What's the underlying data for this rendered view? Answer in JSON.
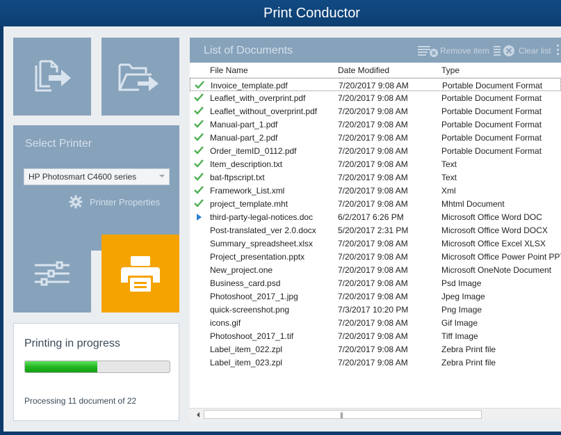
{
  "window": {
    "title": "Print Conductor"
  },
  "toolbar": {
    "add_files_icon": "add-files-icon",
    "add_folder_icon": "add-folder-icon",
    "settings_icon": "sliders-icon",
    "print_icon": "printer-icon"
  },
  "printer": {
    "section_label": "Select Printer",
    "selected": "HP Photosmart C4600 series",
    "properties_label": "Printer Properties"
  },
  "progress": {
    "title": "Printing in progress",
    "fraction": 0.5,
    "status_text": "Processing 11 document of 22"
  },
  "documents": {
    "title": "List of Documents",
    "remove_label": "Remove item",
    "clear_label": "Clear list",
    "columns": {
      "name": "File Name",
      "date": "Date Modified",
      "type": "Type"
    },
    "rows": [
      {
        "name": "Invoice_template.pdf",
        "date": "7/20/2017 9:08 AM",
        "type": "Portable Document Format",
        "status": "done"
      },
      {
        "name": "Leaflet_with_overprint.pdf",
        "date": "7/20/2017 9:08 AM",
        "type": "Portable Document Format",
        "status": "done"
      },
      {
        "name": "Leaflet_without_overprint.pdf",
        "date": "7/20/2017 9:08 AM",
        "type": "Portable Document Format",
        "status": "done"
      },
      {
        "name": "Manual-part_1.pdf",
        "date": "7/20/2017 9:08 AM",
        "type": "Portable Document Format",
        "status": "done"
      },
      {
        "name": "Manual-part_2.pdf",
        "date": "7/20/2017 9:08 AM",
        "type": "Portable Document Format",
        "status": "done"
      },
      {
        "name": "Order_itemID_0112.pdf",
        "date": "7/20/2017 9:08 AM",
        "type": "Portable Document Format",
        "status": "done"
      },
      {
        "name": "Item_description.txt",
        "date": "7/20/2017 9:08 AM",
        "type": "Text",
        "status": "done"
      },
      {
        "name": "bat-ftpscript.txt",
        "date": "7/20/2017 9:08 AM",
        "type": "Text",
        "status": "done"
      },
      {
        "name": "Framework_List.xml",
        "date": "7/20/2017 9:08 AM",
        "type": "Xml",
        "status": "done"
      },
      {
        "name": "project_template.mht",
        "date": "7/20/2017 9:08 AM",
        "type": "Mhtml Document",
        "status": "done"
      },
      {
        "name": "third-party-legal-notices.doc",
        "date": "6/2/2017 6:26 PM",
        "type": "Microsoft Office Word DOC",
        "status": "current"
      },
      {
        "name": "Post-translated_ver 2.0.docx",
        "date": "5/20/2017 2:31 PM",
        "type": "Microsoft Office Word DOCX",
        "status": ""
      },
      {
        "name": "Summary_spreadsheet.xlsx",
        "date": "7/20/2017 9:08 AM",
        "type": "Microsoft Office Excel XLSX",
        "status": ""
      },
      {
        "name": "Project_presentation.pptx",
        "date": "7/20/2017 9:08 AM",
        "type": "Microsoft Office Power Point PPT",
        "status": ""
      },
      {
        "name": "New_project.one",
        "date": "7/20/2017 9:08 AM",
        "type": "Microsoft OneNote Document",
        "status": ""
      },
      {
        "name": "Business_card.psd",
        "date": "7/20/2017 9:08 AM",
        "type": "Psd Image",
        "status": ""
      },
      {
        "name": "Photoshoot_2017_1.jpg",
        "date": "7/20/2017 9:08 AM",
        "type": "Jpeg Image",
        "status": ""
      },
      {
        "name": "quick-screenshot.png",
        "date": "7/3/2017 10:20 PM",
        "type": "Png Image",
        "status": ""
      },
      {
        "name": "icons.gif",
        "date": "7/20/2017 9:08 AM",
        "type": "Gif Image",
        "status": ""
      },
      {
        "name": "Photoshoot_2017_1.tif",
        "date": "7/20/2017 9:08 AM",
        "type": "Tiff Image",
        "status": ""
      },
      {
        "name": "Label_item_022.zpl",
        "date": "7/20/2017 9:08 AM",
        "type": "Zebra Print file",
        "status": ""
      },
      {
        "name": "Label_item_023.zpl",
        "date": "7/20/2017 9:08 AM",
        "type": "Zebra Print file",
        "status": ""
      }
    ]
  },
  "colors": {
    "title_bar": "#0d3f72",
    "tile": "#87a2bb",
    "print_button": "#f5a300",
    "progress_fill": "#1fb31f",
    "done_check": "#4caf50",
    "current_arrow": "#2a7fd4"
  }
}
